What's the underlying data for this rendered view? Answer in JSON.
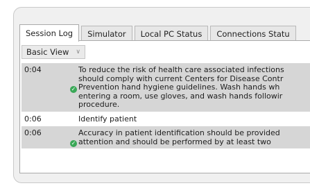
{
  "tabs": [
    {
      "label": "Session Log",
      "active": true
    },
    {
      "label": "Simulator",
      "active": false
    },
    {
      "label": "Local PC Status",
      "active": false
    },
    {
      "label": "Connections Statu",
      "active": false
    }
  ],
  "view": {
    "selected": "Basic View"
  },
  "log": [
    {
      "time": "0:04",
      "lines": [
        "To reduce the risk of health care associated infections",
        "should comply with current Centers for Disease Contr",
        "Prevention hand hygiene guidelines. Wash hands wh",
        "entering a room, use gloves, and wash hands followir",
        "procedure."
      ],
      "status_icon": "check-circle-icon"
    },
    {
      "time": "0:06",
      "lines": [
        "Identify patient"
      ],
      "status_icon": null
    },
    {
      "time": "0:06",
      "lines": [
        "Accuracy in patient identification should be provided",
        "attention and should be performed by at least two"
      ],
      "status_icon": "check-circle-icon"
    }
  ],
  "colors": {
    "row_shaded": "#d6d6d6",
    "check_green": "#3aa857",
    "panel_bg": "#f0f0f0"
  }
}
